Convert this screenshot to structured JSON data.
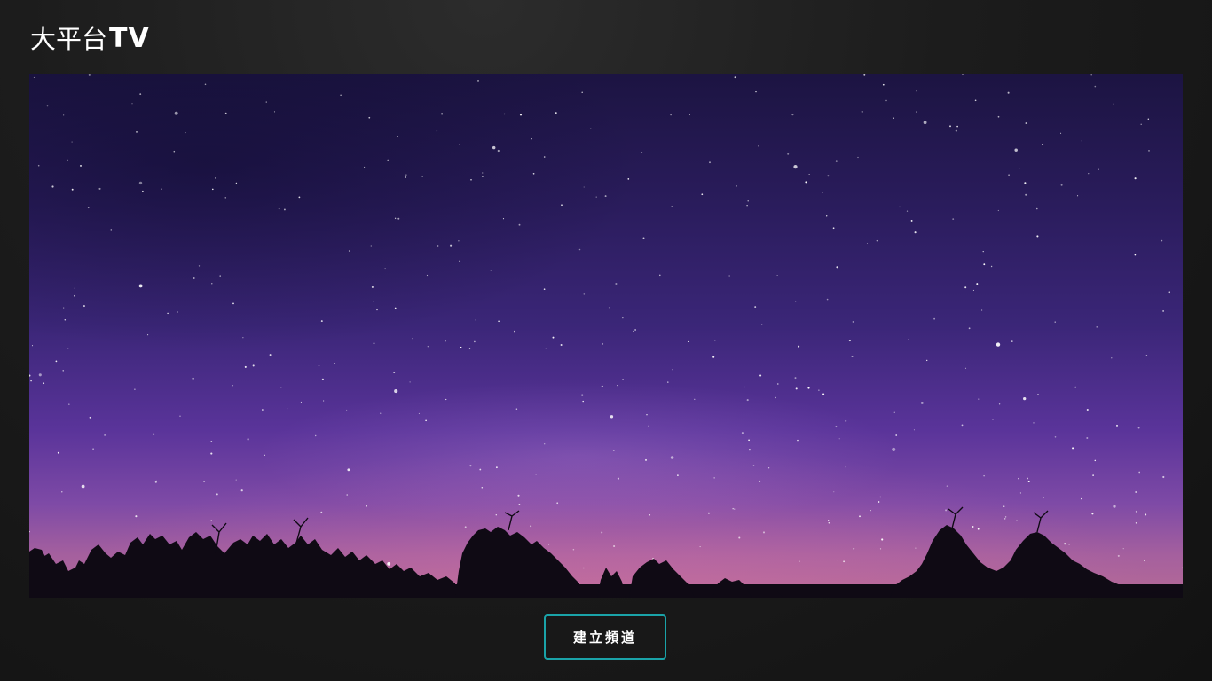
{
  "app": {
    "logo_cjk": "大平台",
    "logo_latin": "TV"
  },
  "hero": {
    "image_subject": "starry-night-sky-with-treeline",
    "sky_top_color": "#1c1442",
    "sky_bottom_color": "#b56a96"
  },
  "actions": {
    "create_channel_label": "建立頻道",
    "accent_color": "#1aa3a8"
  }
}
